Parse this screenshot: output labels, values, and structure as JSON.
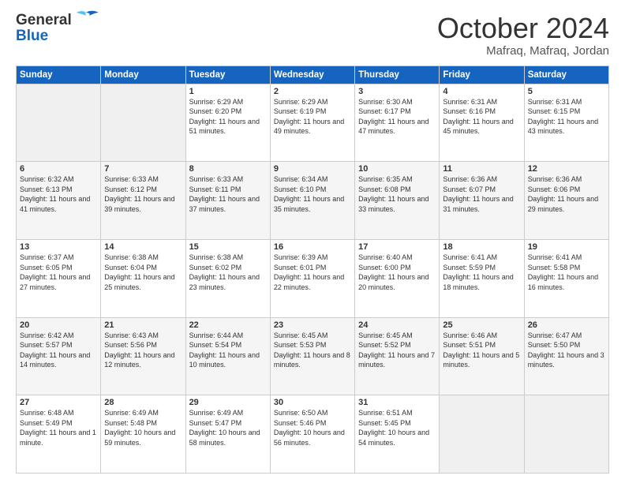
{
  "header": {
    "logo_line1": "General",
    "logo_line2": "Blue",
    "month": "October 2024",
    "location": "Mafraq, Mafraq, Jordan"
  },
  "weekdays": [
    "Sunday",
    "Monday",
    "Tuesday",
    "Wednesday",
    "Thursday",
    "Friday",
    "Saturday"
  ],
  "weeks": [
    [
      null,
      null,
      {
        "day": 1,
        "sunrise": "6:29 AM",
        "sunset": "6:20 PM",
        "daylight": "11 hours and 51 minutes."
      },
      {
        "day": 2,
        "sunrise": "6:29 AM",
        "sunset": "6:19 PM",
        "daylight": "11 hours and 49 minutes."
      },
      {
        "day": 3,
        "sunrise": "6:30 AM",
        "sunset": "6:17 PM",
        "daylight": "11 hours and 47 minutes."
      },
      {
        "day": 4,
        "sunrise": "6:31 AM",
        "sunset": "6:16 PM",
        "daylight": "11 hours and 45 minutes."
      },
      {
        "day": 5,
        "sunrise": "6:31 AM",
        "sunset": "6:15 PM",
        "daylight": "11 hours and 43 minutes."
      }
    ],
    [
      {
        "day": 6,
        "sunrise": "6:32 AM",
        "sunset": "6:13 PM",
        "daylight": "11 hours and 41 minutes."
      },
      {
        "day": 7,
        "sunrise": "6:33 AM",
        "sunset": "6:12 PM",
        "daylight": "11 hours and 39 minutes."
      },
      {
        "day": 8,
        "sunrise": "6:33 AM",
        "sunset": "6:11 PM",
        "daylight": "11 hours and 37 minutes."
      },
      {
        "day": 9,
        "sunrise": "6:34 AM",
        "sunset": "6:10 PM",
        "daylight": "11 hours and 35 minutes."
      },
      {
        "day": 10,
        "sunrise": "6:35 AM",
        "sunset": "6:08 PM",
        "daylight": "11 hours and 33 minutes."
      },
      {
        "day": 11,
        "sunrise": "6:36 AM",
        "sunset": "6:07 PM",
        "daylight": "11 hours and 31 minutes."
      },
      {
        "day": 12,
        "sunrise": "6:36 AM",
        "sunset": "6:06 PM",
        "daylight": "11 hours and 29 minutes."
      }
    ],
    [
      {
        "day": 13,
        "sunrise": "6:37 AM",
        "sunset": "6:05 PM",
        "daylight": "11 hours and 27 minutes."
      },
      {
        "day": 14,
        "sunrise": "6:38 AM",
        "sunset": "6:04 PM",
        "daylight": "11 hours and 25 minutes."
      },
      {
        "day": 15,
        "sunrise": "6:38 AM",
        "sunset": "6:02 PM",
        "daylight": "11 hours and 23 minutes."
      },
      {
        "day": 16,
        "sunrise": "6:39 AM",
        "sunset": "6:01 PM",
        "daylight": "11 hours and 22 minutes."
      },
      {
        "day": 17,
        "sunrise": "6:40 AM",
        "sunset": "6:00 PM",
        "daylight": "11 hours and 20 minutes."
      },
      {
        "day": 18,
        "sunrise": "6:41 AM",
        "sunset": "5:59 PM",
        "daylight": "11 hours and 18 minutes."
      },
      {
        "day": 19,
        "sunrise": "6:41 AM",
        "sunset": "5:58 PM",
        "daylight": "11 hours and 16 minutes."
      }
    ],
    [
      {
        "day": 20,
        "sunrise": "6:42 AM",
        "sunset": "5:57 PM",
        "daylight": "11 hours and 14 minutes."
      },
      {
        "day": 21,
        "sunrise": "6:43 AM",
        "sunset": "5:56 PM",
        "daylight": "11 hours and 12 minutes."
      },
      {
        "day": 22,
        "sunrise": "6:44 AM",
        "sunset": "5:54 PM",
        "daylight": "11 hours and 10 minutes."
      },
      {
        "day": 23,
        "sunrise": "6:45 AM",
        "sunset": "5:53 PM",
        "daylight": "11 hours and 8 minutes."
      },
      {
        "day": 24,
        "sunrise": "6:45 AM",
        "sunset": "5:52 PM",
        "daylight": "11 hours and 7 minutes."
      },
      {
        "day": 25,
        "sunrise": "6:46 AM",
        "sunset": "5:51 PM",
        "daylight": "11 hours and 5 minutes."
      },
      {
        "day": 26,
        "sunrise": "6:47 AM",
        "sunset": "5:50 PM",
        "daylight": "11 hours and 3 minutes."
      }
    ],
    [
      {
        "day": 27,
        "sunrise": "6:48 AM",
        "sunset": "5:49 PM",
        "daylight": "11 hours and 1 minute."
      },
      {
        "day": 28,
        "sunrise": "6:49 AM",
        "sunset": "5:48 PM",
        "daylight": "10 hours and 59 minutes."
      },
      {
        "day": 29,
        "sunrise": "6:49 AM",
        "sunset": "5:47 PM",
        "daylight": "10 hours and 58 minutes."
      },
      {
        "day": 30,
        "sunrise": "6:50 AM",
        "sunset": "5:46 PM",
        "daylight": "10 hours and 56 minutes."
      },
      {
        "day": 31,
        "sunrise": "6:51 AM",
        "sunset": "5:45 PM",
        "daylight": "10 hours and 54 minutes."
      },
      null,
      null
    ]
  ],
  "labels": {
    "sunrise": "Sunrise:",
    "sunset": "Sunset:",
    "daylight": "Daylight:"
  }
}
